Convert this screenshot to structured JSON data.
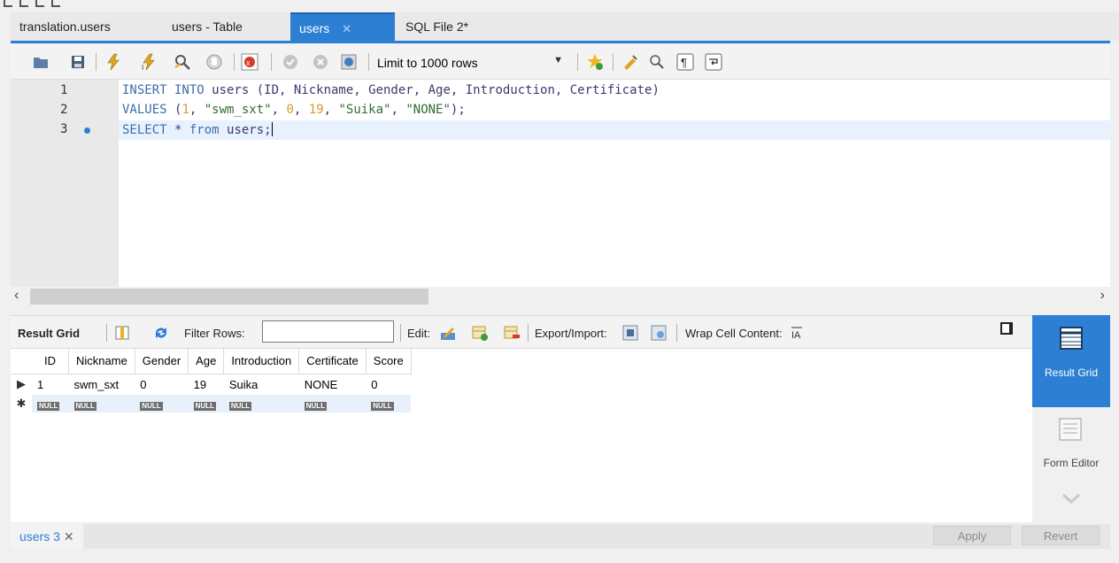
{
  "tabs": [
    {
      "label": "translation.users",
      "active": false
    },
    {
      "label": "users - Table",
      "active": false
    },
    {
      "label": "users",
      "active": true
    },
    {
      "label": "SQL File 2*",
      "active": false
    }
  ],
  "toolbar": {
    "limit_label": "Limit to 1000 rows",
    "icons": [
      "open-file-icon",
      "save-icon",
      "execute-icon",
      "execute-current-icon",
      "explain-icon",
      "stop-icon",
      "error-toggle-icon",
      "commit-icon",
      "rollback-icon",
      "autocommit-icon",
      "bookmark-icon",
      "beautify-icon",
      "find-icon",
      "invisible-chars-icon",
      "word-wrap-icon"
    ]
  },
  "editor": {
    "lines": [
      {
        "num": "1",
        "text": "INSERT INTO users (ID, Nickname, Gender, Age, Introduction, Certificate)"
      },
      {
        "num": "2",
        "text": "VALUES (1, \"swm_sxt\", 0, 19, \"Suika\", \"NONE\");"
      },
      {
        "num": "3",
        "text": "SELECT * from users;"
      }
    ]
  },
  "result_toolbar": {
    "result_grid": "Result Grid",
    "filter_rows": "Filter Rows:",
    "edit": "Edit:",
    "export_import": "Export/Import:",
    "wrap": "Wrap Cell Content:",
    "filter_value": ""
  },
  "grid": {
    "columns": [
      "ID",
      "Nickname",
      "Gender",
      "Age",
      "Introduction",
      "Certificate",
      "Score"
    ],
    "rows": [
      [
        "1",
        "swm_sxt",
        "0",
        "19",
        "Suika",
        "NONE",
        "0"
      ]
    ],
    "null_label": "NULL"
  },
  "right_panel": {
    "result_grid": "Result Grid",
    "form_editor": "Form Editor"
  },
  "bottom": {
    "result_tab": "users 3",
    "apply": "Apply",
    "revert": "Revert"
  },
  "colors": {
    "accent": "#2d7fd3"
  }
}
